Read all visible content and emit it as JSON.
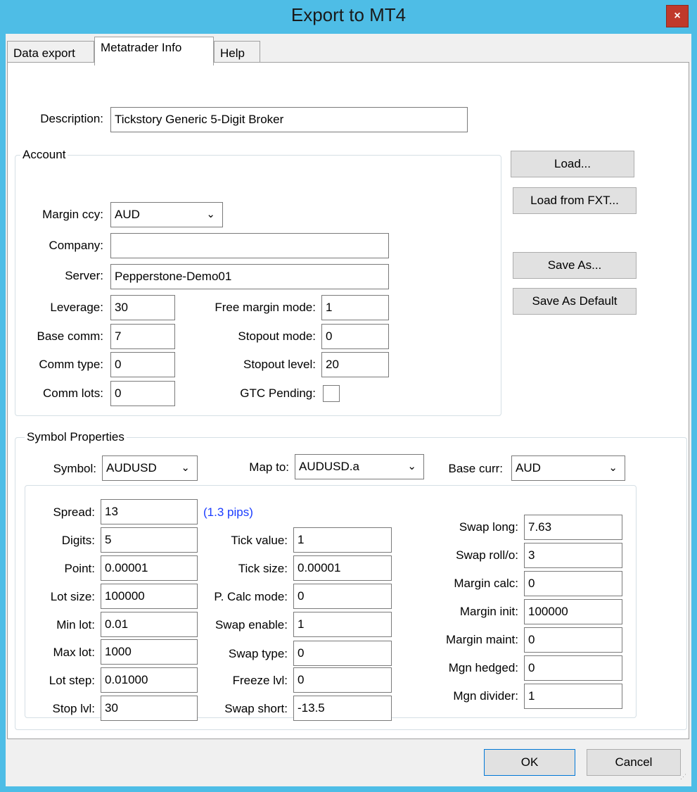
{
  "window": {
    "title": "Export to MT4",
    "close_glyph": "×"
  },
  "tabs": [
    "Data export",
    "Metatrader Info",
    "Help"
  ],
  "description": {
    "label": "Description:",
    "value": "Tickstory Generic 5-Digit Broker"
  },
  "account": {
    "title": "Account",
    "margin_ccy_label": "Margin ccy:",
    "margin_ccy_value": "AUD",
    "company_label": "Company:",
    "company_value": "",
    "server_label": "Server:",
    "server_value": "Pepperstone-Demo01",
    "leverage_label": "Leverage:",
    "leverage_value": "30",
    "base_comm_label": "Base comm:",
    "base_comm_value": "7",
    "comm_type_label": "Comm type:",
    "comm_type_value": "0",
    "comm_lots_label": "Comm lots:",
    "comm_lots_value": "0",
    "free_margin_label": "Free margin mode:",
    "free_margin_value": "1",
    "stopout_mode_label": "Stopout mode:",
    "stopout_mode_value": "0",
    "stopout_level_label": "Stopout level:",
    "stopout_level_value": "20",
    "gtc_label": "GTC Pending:"
  },
  "side_buttons": {
    "load": "Load...",
    "load_fxt": "Load from FXT...",
    "save_as": "Save As...",
    "save_default": "Save As Default"
  },
  "symbol": {
    "title": "Symbol Properties",
    "symbol_label": "Symbol:",
    "symbol_value": "AUDUSD",
    "map_label": "Map to:",
    "map_value": "AUDUSD.a",
    "base_label": "Base curr:",
    "base_value": "AUD",
    "spread_label": "Spread:",
    "spread_value": "13",
    "spread_pips": "(1.3 pips)",
    "digits_label": "Digits:",
    "digits_value": "5",
    "point_label": "Point:",
    "point_value": "0.00001",
    "lot_size_label": "Lot size:",
    "lot_size_value": "100000",
    "min_lot_label": "Min lot:",
    "min_lot_value": "0.01",
    "max_lot_label": "Max lot:",
    "max_lot_value": "1000",
    "lot_step_label": "Lot step:",
    "lot_step_value": "0.01000",
    "stop_lvl_label": "Stop lvl:",
    "stop_lvl_value": "30",
    "tick_value_label": "Tick value:",
    "tick_value_value": "1",
    "tick_size_label": "Tick size:",
    "tick_size_value": "0.00001",
    "pcalc_label": "P. Calc mode:",
    "pcalc_value": "0",
    "swap_enable_label": "Swap enable:",
    "swap_enable_value": "1",
    "swap_type_label": "Swap type:",
    "swap_type_value": "0",
    "freeze_label": "Freeze lvl:",
    "freeze_value": "0",
    "swap_short_label": "Swap short:",
    "swap_short_value": "-13.5",
    "swap_long_label": "Swap long:",
    "swap_long_value": "7.63",
    "swap_roll_label": "Swap roll/o:",
    "swap_roll_value": "3",
    "margin_calc_label": "Margin calc:",
    "margin_calc_value": "0",
    "margin_init_label": "Margin init:",
    "margin_init_value": "100000",
    "margin_maint_label": "Margin maint:",
    "margin_maint_value": "0",
    "mgn_hedged_label": "Mgn hedged:",
    "mgn_hedged_value": "0",
    "mgn_divider_label": "Mgn divider:",
    "mgn_divider_value": "1"
  },
  "footer": {
    "ok": "OK",
    "cancel": "Cancel"
  }
}
